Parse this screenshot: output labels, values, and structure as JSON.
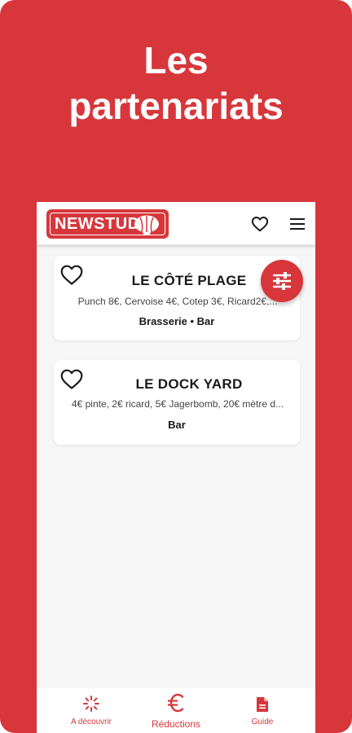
{
  "headline": {
    "line1": "Les",
    "line2": "partenariats"
  },
  "appbar": {
    "logo_text": "NEWSTUD",
    "favorites_icon": "heart-outline-icon",
    "menu_icon": "hamburger-menu-icon"
  },
  "filter_button_icon": "tune-sliders-icon",
  "partners": [
    {
      "name": "LE CÔTÉ PLAGE",
      "offers": "Punch 8€, Cervoise 4€, Cotep 3€, Ricard2€,...",
      "category": "Brasserie • Bar"
    },
    {
      "name": "LE DOCK YARD",
      "offers": "4€ pinte, 2€ ricard, 5€ Jagerbomb, 20€ mètre d...",
      "category": "Bar"
    }
  ],
  "bottom_nav": [
    {
      "label": "A découvrir",
      "icon": "sparkle-icon"
    },
    {
      "label": "Réductions",
      "icon": "euro-icon",
      "active": true
    },
    {
      "label": "Guide",
      "icon": "document-icon"
    }
  ],
  "colors": {
    "brand": "#d7373b",
    "background": "#f6f6f6",
    "card": "#ffffff"
  }
}
